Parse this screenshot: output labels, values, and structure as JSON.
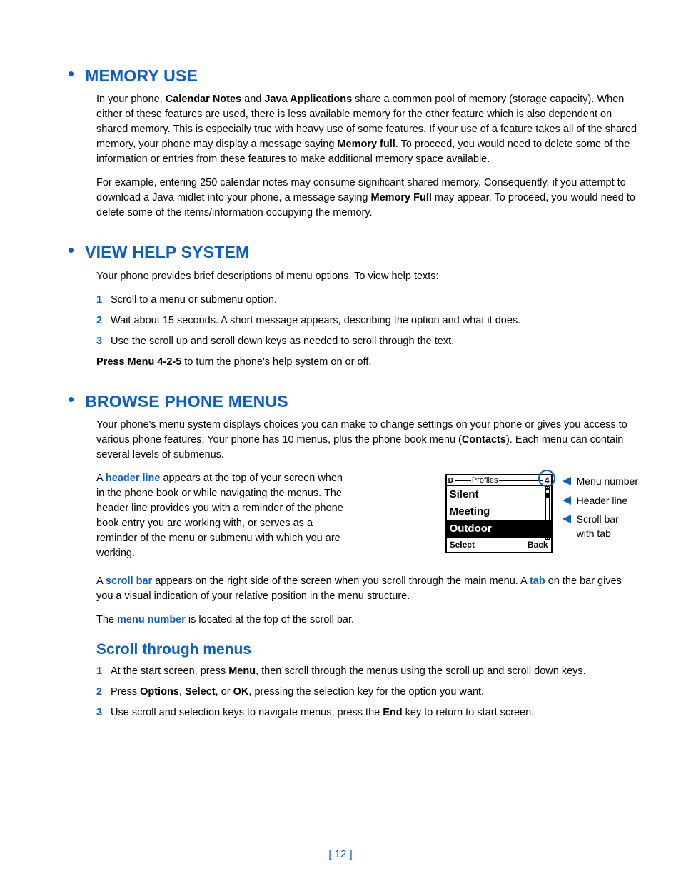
{
  "sections": {
    "memory": {
      "title": "MEMORY USE",
      "p1_pre": "In your phone, ",
      "p1_b1": "Calendar Notes",
      "p1_mid1": " and ",
      "p1_b2": "Java Applications",
      "p1_mid2": " share a common pool of memory (storage capacity). When either of these features are used, there is less available memory for the other feature which is also dependent on shared memory. This is especially true with heavy use of some features. If your use of a feature takes all of the shared memory, your phone may display a message saying ",
      "p1_b3": "Memory full",
      "p1_post": ". To proceed, you would need to delete some of the information or entries from these features to make additional memory space available.",
      "p2_pre": "For example, entering 250 calendar notes may consume significant shared memory. Consequently, if you attempt to download a Java midlet into your phone, a message saying ",
      "p2_b1": "Memory Full",
      "p2_post": " may appear. To proceed, you would need to delete some of the items/information occupying the memory."
    },
    "help": {
      "title": "VIEW HELP SYSTEM",
      "intro": "Your phone provides brief descriptions of menu options. To view help texts:",
      "steps": [
        "Scroll to a menu or submenu option.",
        "Wait about 15 seconds. A short message appears, describing the option and what it does.",
        "Use the scroll up and scroll down keys as needed to scroll through the text."
      ],
      "press_b": "Press Menu 4-2-5",
      "press_rest": " to turn the phone's help system on or off."
    },
    "browse": {
      "title": "BROWSE PHONE MENUS",
      "intro_pre": "Your phone's menu system displays choices you can make to change settings on your phone or gives you access to various phone features. Your phone has 10 menus, plus the phone book menu (",
      "intro_b": "Contacts",
      "intro_post": "). Each menu can contain several levels of submenus.",
      "header_pre": "A ",
      "header_kw": "header line",
      "header_post": " appears at the top of your screen when in the phone book or while navigating the menus. The header line provides you with a reminder of the phone book entry you are working with, or serves as a reminder of the menu or submenu with which you are working.",
      "scroll_pre": "A ",
      "scroll_kw": "scroll bar",
      "scroll_mid": " appears on the right side of the screen when you scroll through the main menu. A ",
      "scroll_kw2": "tab",
      "scroll_post": " on the bar gives you a visual indication of your relative position in the menu structure.",
      "menunum_pre": "The ",
      "menunum_kw": "menu number",
      "menunum_post": " is located at the top of the scroll bar.",
      "sub_title": "Scroll through menus",
      "steps": {
        "s1_pre": "At the start screen, press ",
        "s1_b": "Menu",
        "s1_post": ", then scroll through the menus using the scroll up and scroll down keys.",
        "s2_pre": "Press ",
        "s2_b1": "Options",
        "s2_c1": ", ",
        "s2_b2": "Select",
        "s2_c2": ", or ",
        "s2_b3": "OK",
        "s2_post": ", pressing the selection key for the option you want.",
        "s3_pre": "Use scroll and selection keys to navigate menus; press the ",
        "s3_b": "End",
        "s3_post": " key to return to start screen."
      }
    }
  },
  "figure": {
    "header_d": "D",
    "header_title": "Profiles",
    "header_num": "4",
    "rows": [
      "Silent",
      "Meeting",
      "Outdoor"
    ],
    "soft_left": "Select",
    "soft_right": "Back",
    "callouts": {
      "menu_number": "Menu number",
      "header_line": "Header line",
      "scroll_bar_l1": "Scroll bar",
      "scroll_bar_l2": "with tab"
    }
  },
  "page_number": "[ 12 ]"
}
